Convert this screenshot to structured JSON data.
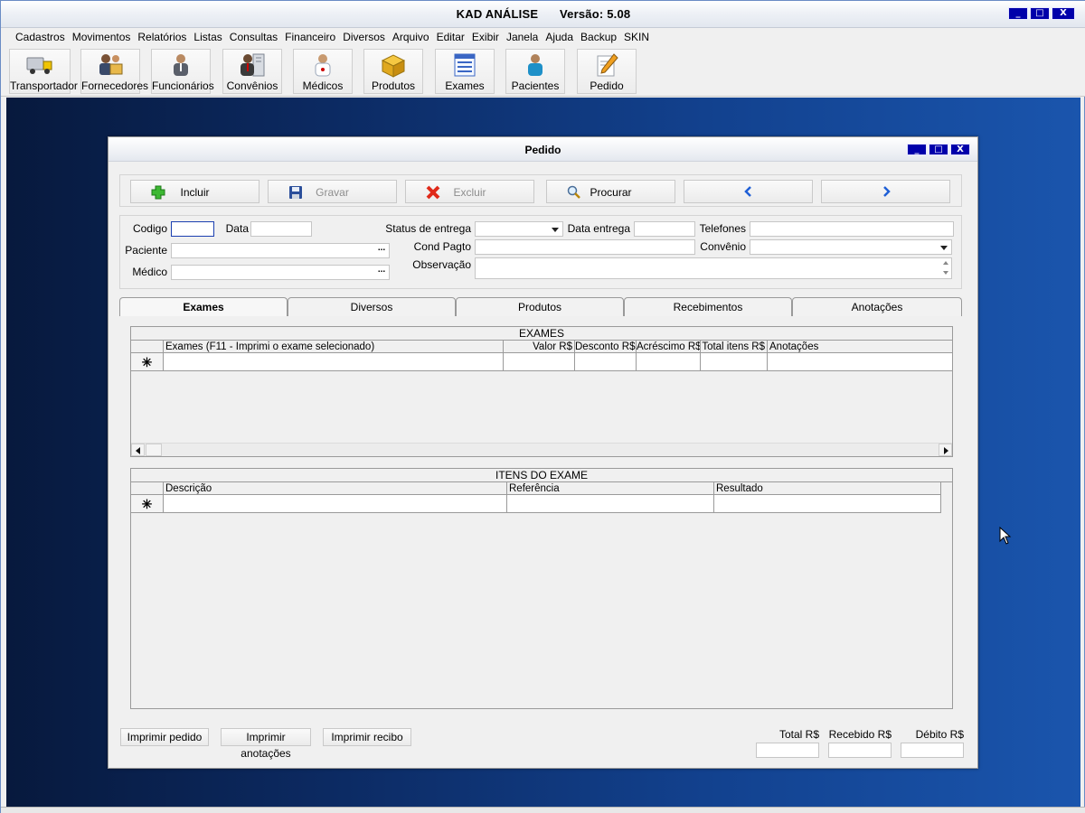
{
  "app": {
    "title": "KAD ANÁLISE",
    "version": "Versão: 5.08"
  },
  "menu": [
    "Cadastros",
    "Movimentos",
    "Relatórios",
    "Listas",
    "Consultas",
    "Financeiro",
    "Diversos",
    "Arquivo",
    "Editar",
    "Exibir",
    "Janela",
    "Ajuda",
    "Backup",
    "SKIN"
  ],
  "toolbar": [
    {
      "label": "Transportador",
      "icon": "truck-icon"
    },
    {
      "label": "Fornecedores",
      "icon": "suppliers-icon"
    },
    {
      "label": "Funcionários",
      "icon": "employee-icon"
    },
    {
      "label": "Convênios",
      "icon": "agreement-icon"
    },
    {
      "label": "Médicos",
      "icon": "doctor-icon"
    },
    {
      "label": "Produtos",
      "icon": "box-icon"
    },
    {
      "label": "Exames",
      "icon": "list-icon"
    },
    {
      "label": "Pacientes",
      "icon": "patient-icon"
    },
    {
      "label": "Pedido",
      "icon": "pencil-icon"
    }
  ],
  "window": {
    "title": "Pedido",
    "actions": {
      "incluir": "Incluir",
      "gravar": "Gravar",
      "excluir": "Excluir",
      "procurar": "Procurar"
    },
    "form": {
      "codigo": "Codigo",
      "data": "Data",
      "paciente": "Paciente",
      "medico": "Médico",
      "status_entrega": "Status de entrega",
      "data_entrega": "Data entrega",
      "cond_pagto": "Cond Pagto",
      "observacao": "Observação",
      "telefones": "Telefones",
      "convenio": "Convênio",
      "ellipsis": "..."
    },
    "tabs": [
      "Exames",
      "Diversos",
      "Produtos",
      "Recebimentos",
      "Anotações"
    ],
    "exames_grid": {
      "title": "EXAMES",
      "columns": [
        "Exames  (F11 - Imprimi o exame selecionado)",
        "Valor R$",
        "Desconto R$",
        "Acréscimo R$",
        "Total itens R$",
        "Anotações"
      ],
      "new_row_marker": "✳"
    },
    "itens_grid": {
      "title": "ITENS DO EXAME",
      "columns": [
        "Descrição",
        "Referência",
        "Resultado"
      ],
      "new_row_marker": "✳"
    },
    "footer": {
      "imprimir_pedido": "Imprimir pedido",
      "imprimir_anotacoes": "Imprimir anotações",
      "imprimir_recibo": "Imprimir recibo",
      "total": "Total R$",
      "recebido": "Recebido R$",
      "debito": "Débito R$"
    }
  },
  "colors": {
    "desktop_dark": "#07193d",
    "desktop_light": "#1a55ad",
    "window_button": "#0000aa",
    "nav_arrow": "#1f5fd6"
  }
}
